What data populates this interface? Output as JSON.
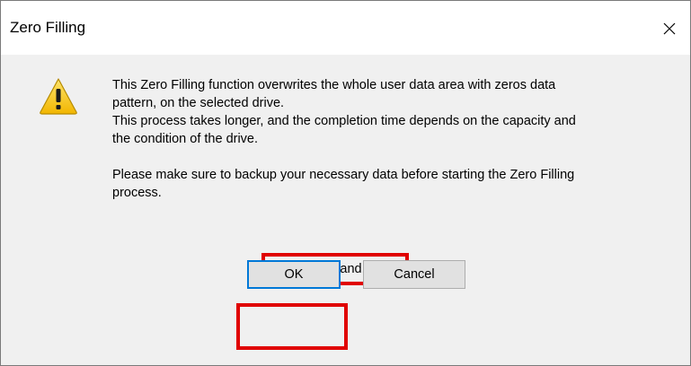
{
  "window": {
    "title": "Zero Filling",
    "close_glyph": "✕"
  },
  "message": {
    "line1": "This Zero Filling function overwrites the whole user data area with zeros data",
    "line2": "pattern, on the selected drive.",
    "line3": "This process takes longer, and the completion time depends on the capacity and",
    "line4": "the condition of the drive.",
    "line5": "Please make sure to backup your necessary data before starting the Zero Filling",
    "line6": "process."
  },
  "icon": {
    "name": "warning-icon",
    "fill": "#f5c400",
    "mark": "!"
  },
  "checkbox": {
    "label": "I understand.",
    "checked": true
  },
  "buttons": {
    "ok_label": "OK",
    "cancel_label": "Cancel"
  },
  "colors": {
    "highlight": "#e00000",
    "focus": "#0078d7",
    "dialog_bg": "#f0f0f0",
    "button_bg": "#e1e1e1"
  }
}
